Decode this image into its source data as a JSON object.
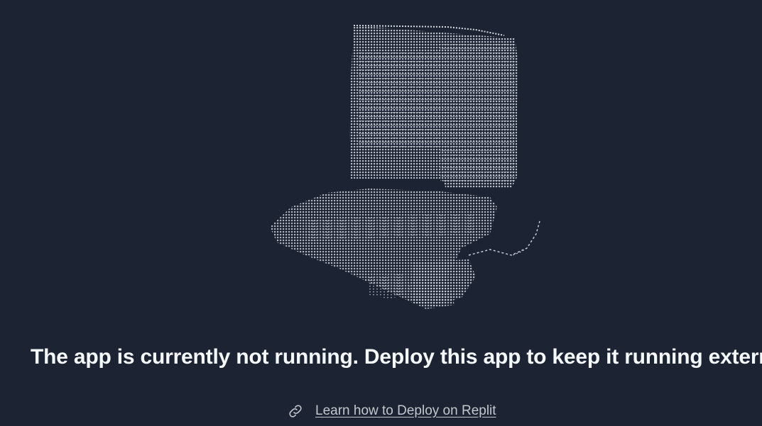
{
  "colors": {
    "background": "#1c2333",
    "text": "#f5f9fc",
    "muted_text": "#c2c8cc",
    "art": "#c8cfd8"
  },
  "illustration": {
    "icon": "ascii-art-boot-illustration"
  },
  "message": {
    "headline": "The app is currently not running. Deploy this app to keep it running externally"
  },
  "learn_link": {
    "icon": "link-icon",
    "label": "Learn how to Deploy on Replit"
  }
}
